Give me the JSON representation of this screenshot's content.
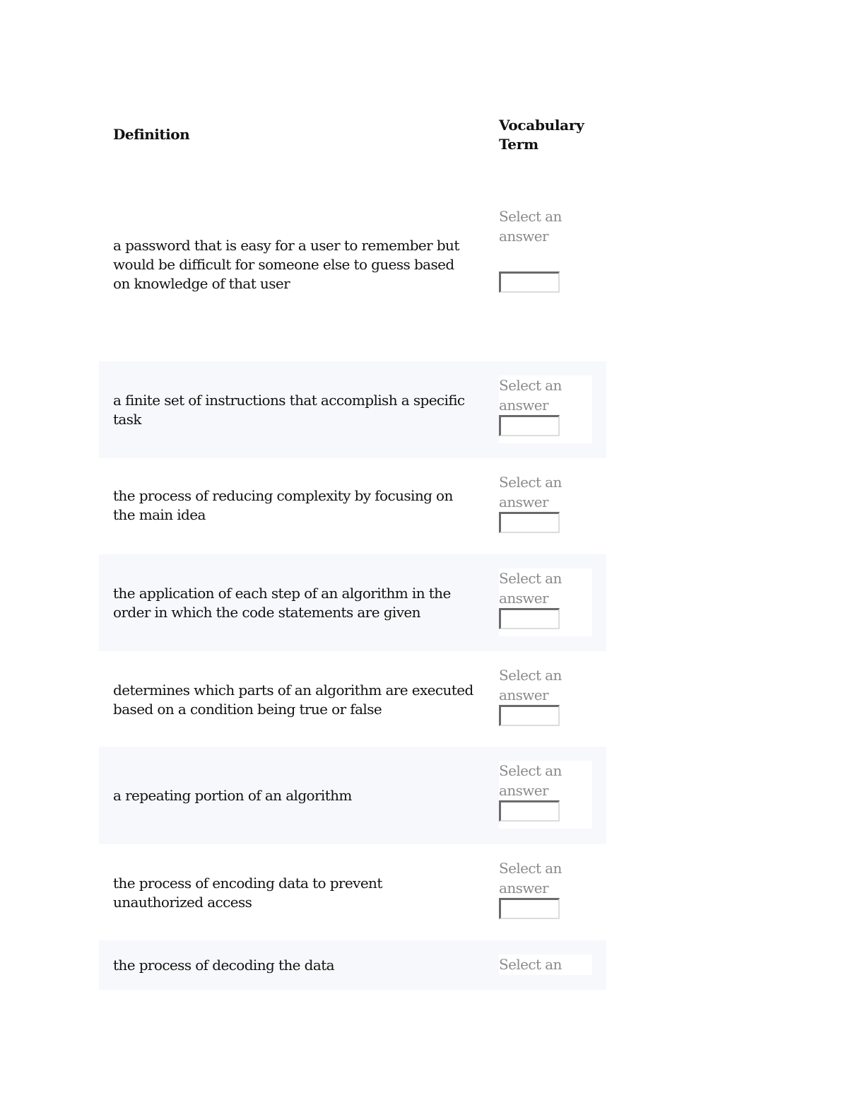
{
  "table": {
    "headers": {
      "definition": "Definition",
      "term": "Vocabulary Term"
    },
    "rows": [
      {
        "definition": "a password that is easy for a user to remember but would be difficult for someone else to guess based on knowledge of that user",
        "answer_placeholder": "Select an answer",
        "answer_value": ""
      },
      {
        "definition": "a finite set of instructions that accomplish a specific task",
        "answer_placeholder": "Select an answer",
        "answer_value": ""
      },
      {
        "definition": "the process of reducing complexity by focusing on the main idea",
        "answer_placeholder": "Select an answer",
        "answer_value": ""
      },
      {
        "definition": "the application of each step of an algorithm in the order in which the code statements are given",
        "answer_placeholder": "Select an answer",
        "answer_value": ""
      },
      {
        "definition": "determines which parts of an algorithm are executed based on a condition being true or false",
        "answer_placeholder": "Select an answer",
        "answer_value": ""
      },
      {
        "definition": "a repeating portion of an algorithm",
        "answer_placeholder": "Select an answer",
        "answer_value": ""
      },
      {
        "definition": "the process of encoding data to prevent unauthorized access",
        "answer_placeholder": "Select an answer",
        "answer_value": ""
      },
      {
        "definition": "the process of decoding the data",
        "answer_placeholder": "Select an",
        "answer_value": ""
      }
    ]
  },
  "colors": {
    "shaded_row": "#f7f8fb",
    "placeholder_text": "#8a8a8a"
  }
}
